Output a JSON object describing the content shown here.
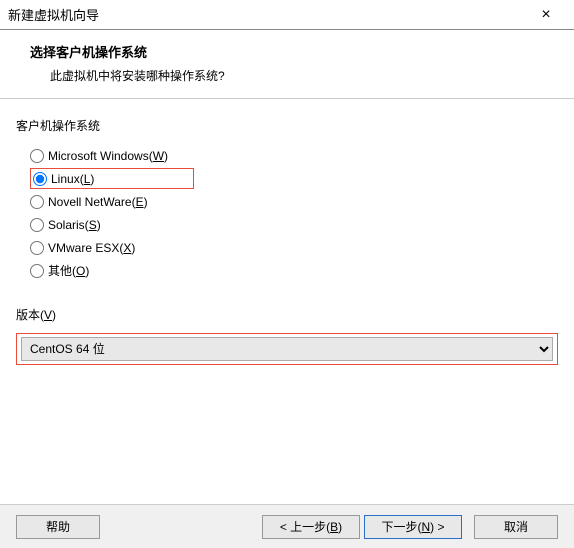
{
  "titlebar": {
    "title": "新建虚拟机向导"
  },
  "header": {
    "heading": "选择客户机操作系统",
    "subheading": "此虚拟机中将安装哪种操作系统?"
  },
  "os": {
    "section_label": "客户机操作系统",
    "options": [
      {
        "label": "Microsoft Windows(",
        "accel": "W",
        "tail": ")"
      },
      {
        "label": "Linux(",
        "accel": "L",
        "tail": ")"
      },
      {
        "label": "Novell NetWare(",
        "accel": "E",
        "tail": ")"
      },
      {
        "label": "Solaris(",
        "accel": "S",
        "tail": ")"
      },
      {
        "label": "VMware ESX(",
        "accel": "X",
        "tail": ")"
      },
      {
        "label": "其他(",
        "accel": "O",
        "tail": ")"
      }
    ]
  },
  "version": {
    "label_pre": "版本(",
    "label_accel": "V",
    "label_post": ")",
    "selected": "CentOS 64 位"
  },
  "footer": {
    "help": "帮助",
    "back_pre": "< 上一步(",
    "back_accel": "B",
    "back_post": ")",
    "next_pre": "下一步(",
    "next_accel": "N",
    "next_post": ") >",
    "cancel": "取消"
  }
}
